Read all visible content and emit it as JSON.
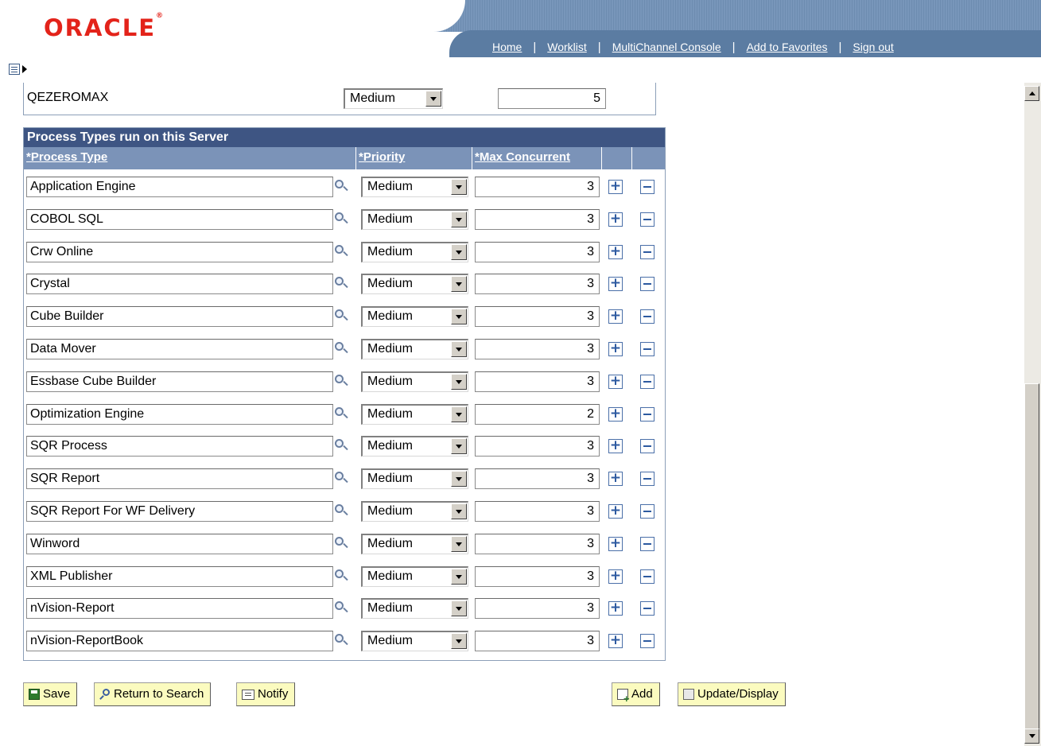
{
  "header": {
    "logo": "ORACLE",
    "nav": [
      "Home",
      "Worklist",
      "MultiChannel Console",
      "Add to Favorites",
      "Sign out"
    ]
  },
  "qe_row": {
    "name": "QEZEROMAX",
    "priority": "Medium",
    "max": "5"
  },
  "grid": {
    "title": "Process Types run on this Server",
    "headers": {
      "process_type": "*Process Type",
      "priority": "*Priority",
      "max_concurrent": "*Max Concurrent"
    },
    "rows": [
      {
        "type": "Application Engine",
        "priority": "Medium",
        "max": "3"
      },
      {
        "type": "COBOL SQL",
        "priority": "Medium",
        "max": "3"
      },
      {
        "type": "Crw Online",
        "priority": "Medium",
        "max": "3"
      },
      {
        "type": "Crystal",
        "priority": "Medium",
        "max": "3"
      },
      {
        "type": "Cube Builder",
        "priority": "Medium",
        "max": "3"
      },
      {
        "type": "Data Mover",
        "priority": "Medium",
        "max": "3"
      },
      {
        "type": "Essbase Cube Builder",
        "priority": "Medium",
        "max": "3"
      },
      {
        "type": "Optimization Engine",
        "priority": "Medium",
        "max": "2"
      },
      {
        "type": "SQR Process",
        "priority": "Medium",
        "max": "3"
      },
      {
        "type": "SQR Report",
        "priority": "Medium",
        "max": "3"
      },
      {
        "type": "SQR Report For WF Delivery",
        "priority": "Medium",
        "max": "3"
      },
      {
        "type": "Winword",
        "priority": "Medium",
        "max": "3"
      },
      {
        "type": "XML Publisher",
        "priority": "Medium",
        "max": "3"
      },
      {
        "type": "nVision-Report",
        "priority": "Medium",
        "max": "3"
      },
      {
        "type": "nVision-ReportBook",
        "priority": "Medium",
        "max": "3"
      }
    ]
  },
  "toolbar": {
    "save": "Save",
    "return_to_search": "Return to Search",
    "notify": "Notify",
    "add": "Add",
    "update_display": "Update/Display"
  },
  "colors": {
    "brand_red": "#e3231a",
    "grid_title": "#3e5583",
    "grid_header": "#7b93b8",
    "button_bg": "#fbfbbf"
  }
}
